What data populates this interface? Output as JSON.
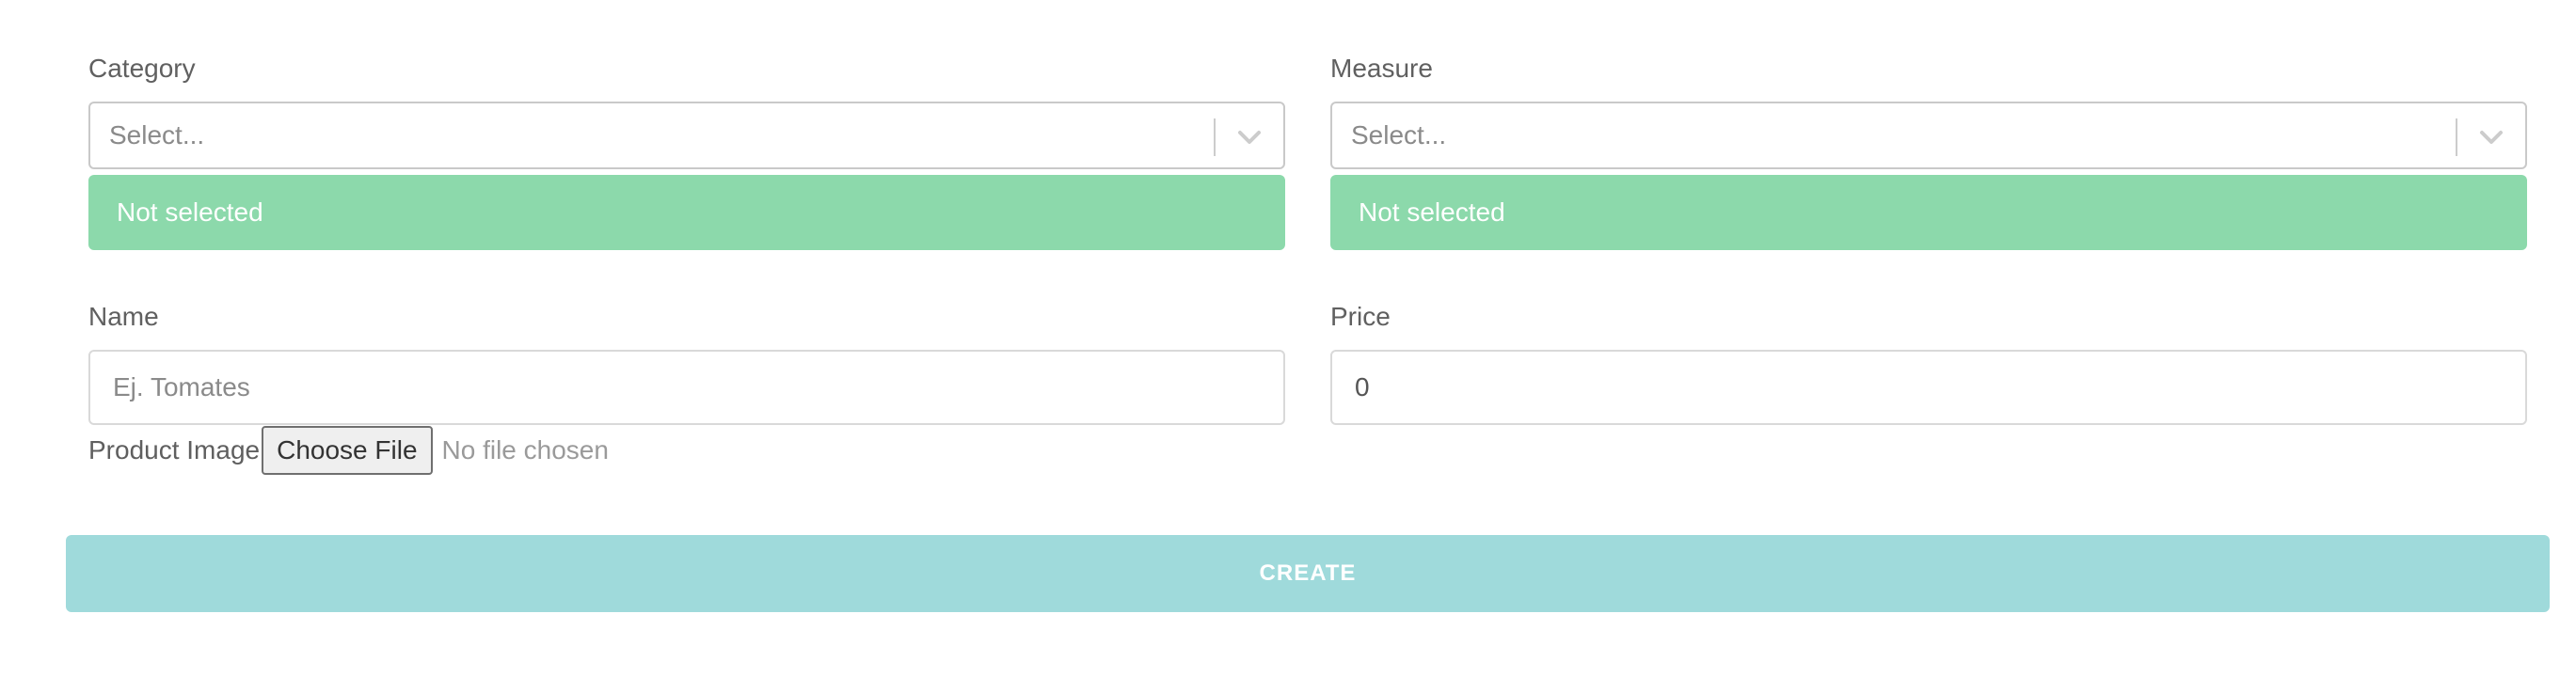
{
  "form": {
    "category": {
      "label": "Category",
      "placeholder": "Select...",
      "status": "Not selected"
    },
    "measure": {
      "label": "Measure",
      "placeholder": "Select...",
      "status": "Not selected"
    },
    "name": {
      "label": "Name",
      "placeholder": "Ej. Tomates",
      "value": ""
    },
    "price": {
      "label": "Price",
      "value": "0"
    },
    "product_image": {
      "label": "Product Image",
      "button_label": "Choose File",
      "status": "No file chosen"
    },
    "create_button": "CREATE"
  },
  "icons": {
    "dropdown": "chevron-down-icon"
  },
  "colors": {
    "alert_background": "#8cd9ab",
    "create_button_background": "#9fdadb"
  }
}
